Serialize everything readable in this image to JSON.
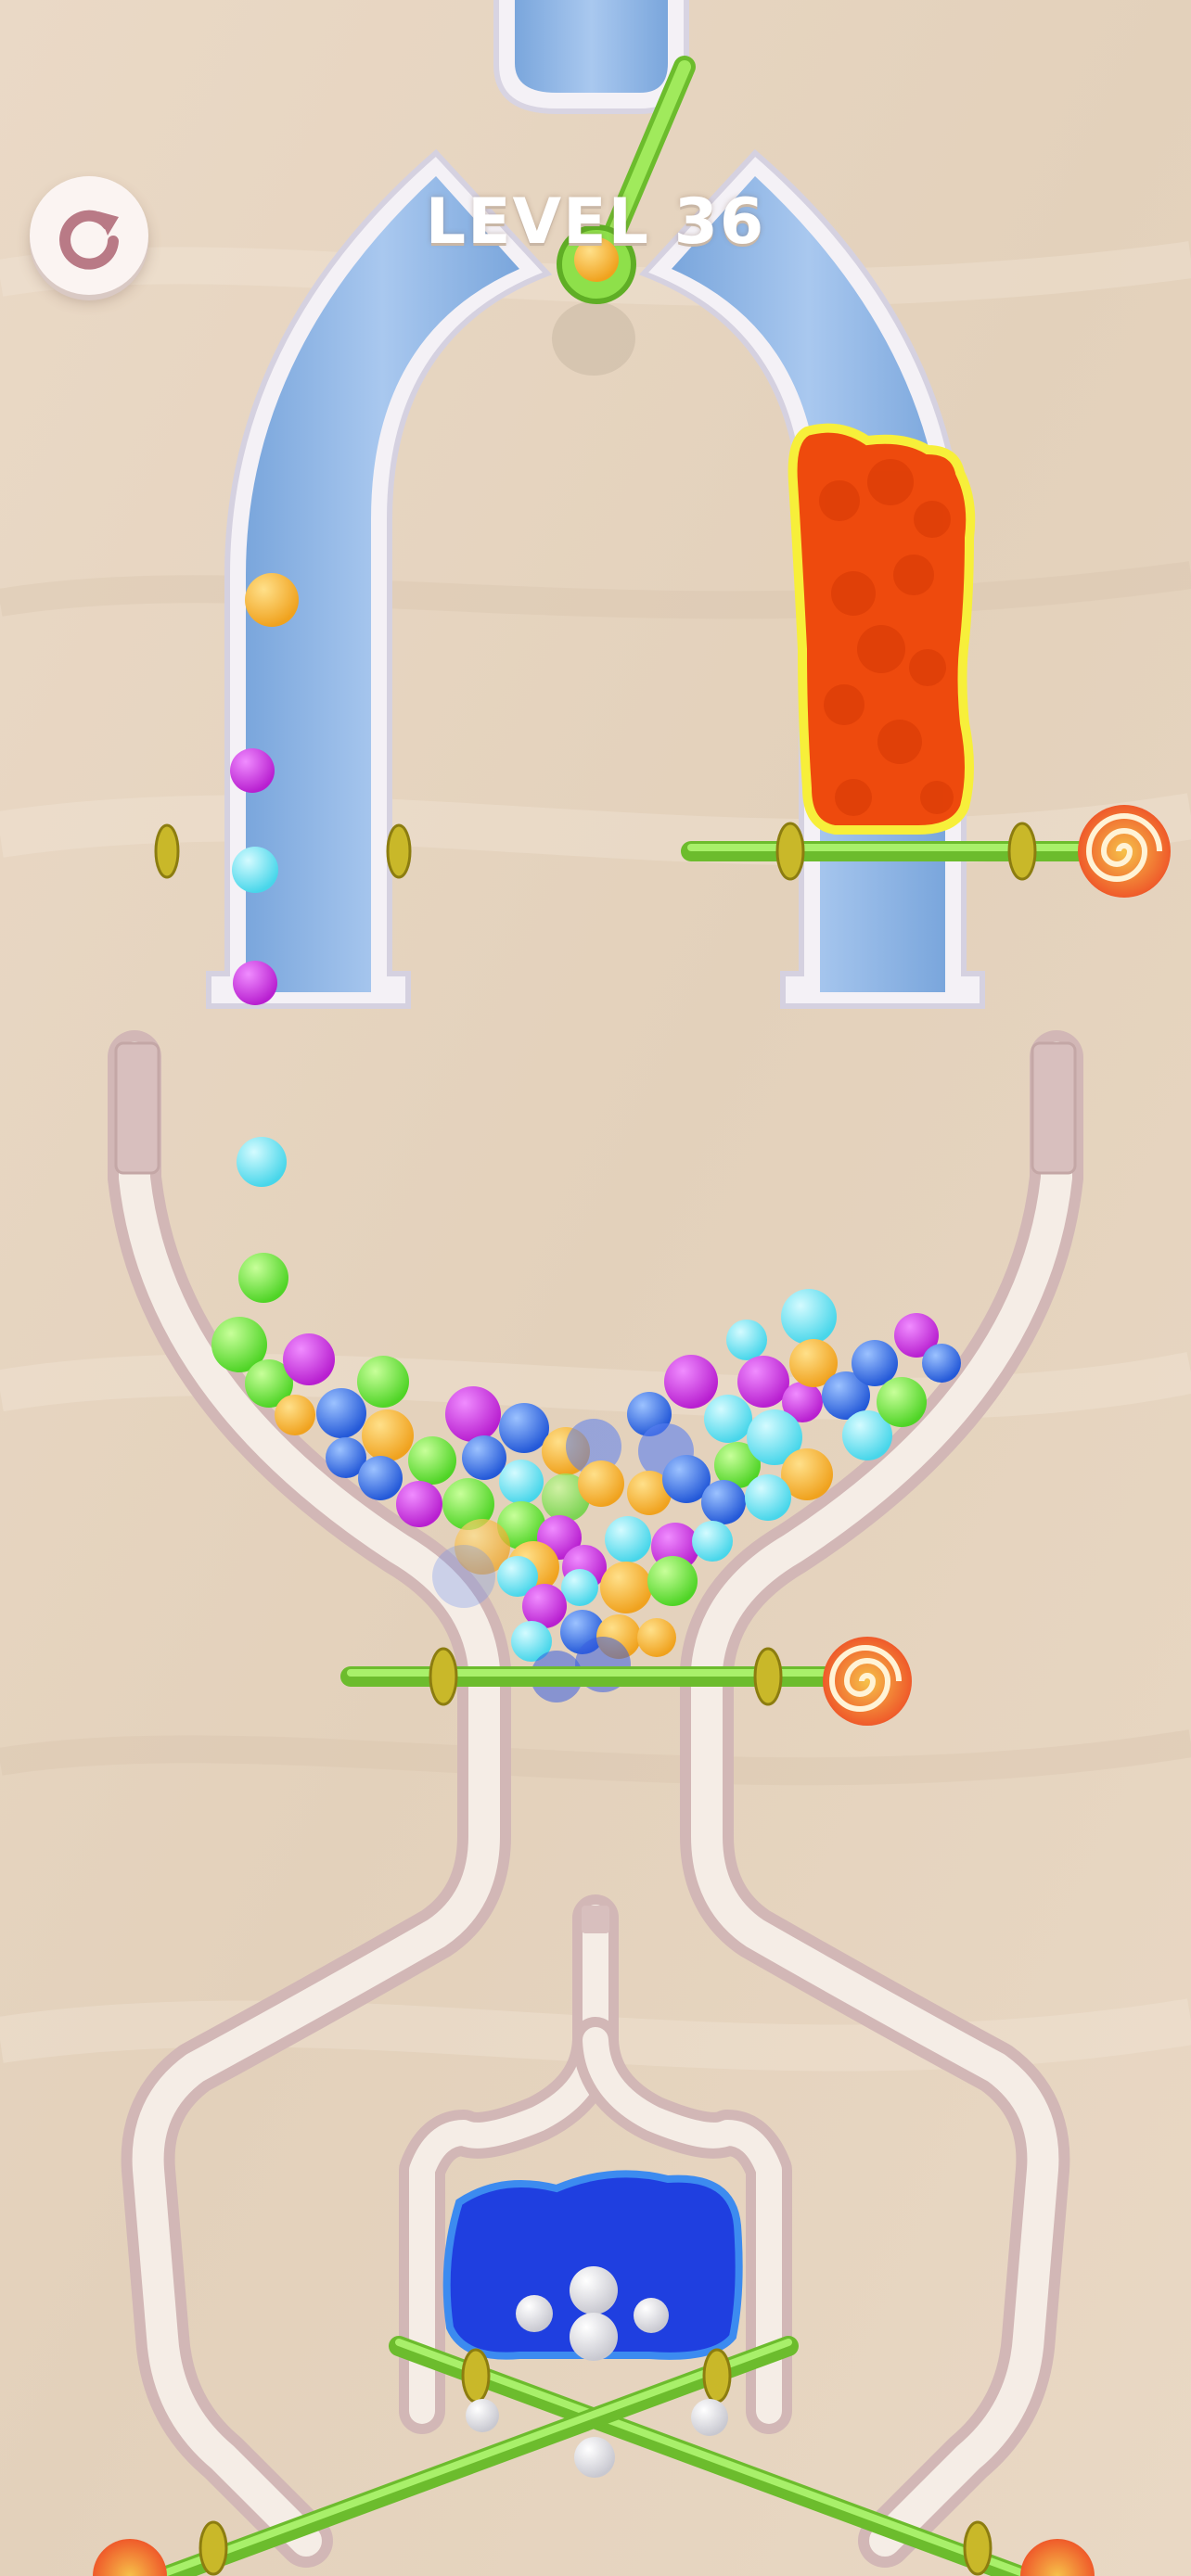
{
  "hud": {
    "level_label": "LEVEL 36",
    "restart_icon": "restart-icon"
  },
  "colors": {
    "background": "#e6d5c0",
    "pipe_blue": "#8fb5e3",
    "tube_cream": "#f5ede6",
    "lava": "#ef4a10",
    "water": "#1f3fe0",
    "pin_green": "#8ee04a",
    "pin_handle_swirl": "#f2703a",
    "ball_colors": [
      "#f5a623",
      "#cc2ee0",
      "#5ee0f0",
      "#69e03a",
      "#2f6ee0"
    ]
  }
}
